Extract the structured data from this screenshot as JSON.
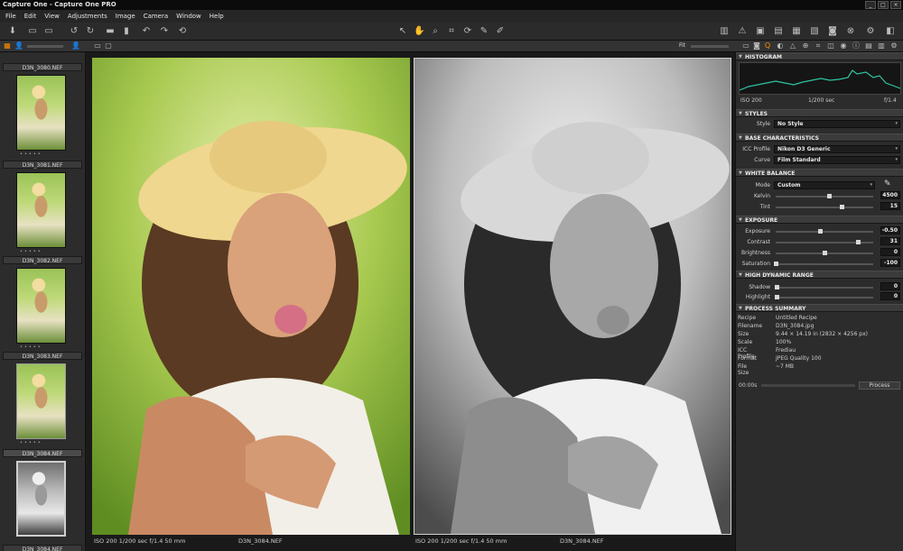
{
  "window": {
    "title": "Capture One - Capture One PRO"
  },
  "menu": [
    "File",
    "Edit",
    "View",
    "Adjustments",
    "Image",
    "Camera",
    "Window",
    "Help"
  ],
  "filmstrip": {
    "items": [
      {
        "label": "D3N_3080.NEF",
        "type": "color"
      },
      {
        "label": "D3N_3081.NEF",
        "type": "color"
      },
      {
        "label": "D3N_3082.NEF",
        "type": "color"
      },
      {
        "label": "D3N_3083.NEF",
        "type": "color"
      },
      {
        "label": "D3N_3084.NEF",
        "type": "bw"
      }
    ]
  },
  "viewer": {
    "left": {
      "exif": "ISO 200   1/200 sec   f/1.4   50 mm",
      "filename": "D3N_3084.NEF"
    },
    "right": {
      "exif": "ISO 200   1/200 sec   f/1.4   50 mm",
      "filename": "D3N_3084.NEF"
    },
    "fit_label": "Fit"
  },
  "tools": {
    "histogram": {
      "title": "HISTOGRAM",
      "iso": "ISO 200",
      "shutter": "1/200 sec",
      "aperture": "f/1.4"
    },
    "styles": {
      "title": "STYLES",
      "style_label": "Style",
      "style_value": "No Style"
    },
    "base": {
      "title": "BASE CHARACTERISTICS",
      "icc_label": "ICC Profile",
      "icc_value": "Nikon D3 Generic",
      "curve_label": "Curve",
      "curve_value": "Film Standard"
    },
    "wb": {
      "title": "WHITE BALANCE",
      "mode_label": "Mode",
      "mode_value": "Custom",
      "kelvin_label": "Kelvin",
      "kelvin_value": "4500",
      "tint_label": "Tint",
      "tint_value": "15",
      "kelvin_level": 0.55,
      "tint_level": 0.68
    },
    "exposure": {
      "title": "EXPOSURE",
      "exposure_label": "Exposure",
      "exposure_value": "-0.50",
      "contrast_label": "Contrast",
      "contrast_value": "31",
      "brightness_label": "Brightness",
      "brightness_value": "0",
      "saturation_label": "Saturation",
      "saturation_value": "-100",
      "levels": [
        0.46,
        0.85,
        0.5,
        0.0
      ]
    },
    "hdr": {
      "title": "HIGH DYNAMIC RANGE",
      "shadow_label": "Shadow",
      "shadow_value": "0",
      "highlight_label": "Highlight",
      "highlight_value": "0"
    },
    "summary": {
      "title": "PROCESS SUMMARY",
      "rows": [
        {
          "k": "Recipe",
          "v": "Untitled Recipe"
        },
        {
          "k": "Filename",
          "v": "D3N_3084.jpg"
        },
        {
          "k": "Size",
          "v": "9.44 × 14.19 in (2832 × 4256 px)"
        },
        {
          "k": "Scale",
          "v": "100%"
        },
        {
          "k": "ICC Profile",
          "v": "Frediau"
        },
        {
          "k": "Format",
          "v": "JPEG Quality 100"
        },
        {
          "k": "File Size",
          "v": "~7 MB"
        }
      ],
      "time": "00:00s",
      "process_label": "Process"
    }
  },
  "colors": {
    "accent": "#ff8c00",
    "panel": "#2c2c2c",
    "header": "#3b3b3b"
  }
}
